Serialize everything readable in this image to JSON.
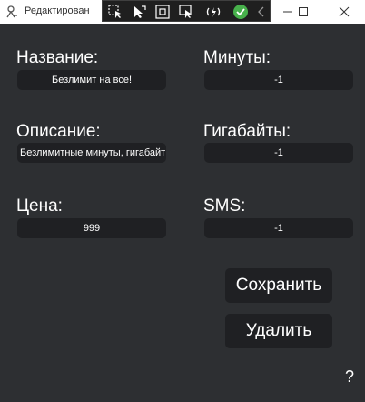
{
  "window": {
    "title": "Редактирован"
  },
  "form": {
    "name_label": "Название:",
    "name_value": "Безлимит на все!",
    "description_label": "Описание:",
    "description_value": "Безлимитные минуты, гигабайты",
    "price_label": "Цена:",
    "price_value": "999",
    "minutes_label": "Минуты:",
    "minutes_value": "-1",
    "gigabytes_label": "Гигабайты:",
    "gigabytes_value": "-1",
    "sms_label": "SMS:",
    "sms_value": "-1"
  },
  "buttons": {
    "save": "Сохранить",
    "delete": "Удалить",
    "help": "?"
  },
  "icons": {
    "app": "app-icon",
    "debug_tools": [
      "select-element-icon",
      "pointer-icon",
      "layout-adorner-icon",
      "track-focus-icon",
      "hot-reload-icon",
      "checked-icon",
      "collapse-chevron-icon"
    ],
    "window_controls": [
      "minimize-icon",
      "maximize-icon",
      "close-icon"
    ]
  },
  "colors": {
    "background": "#2d2f32",
    "field_background": "#1f2023",
    "text": "#ffffff",
    "check_green": "#47b04b"
  }
}
